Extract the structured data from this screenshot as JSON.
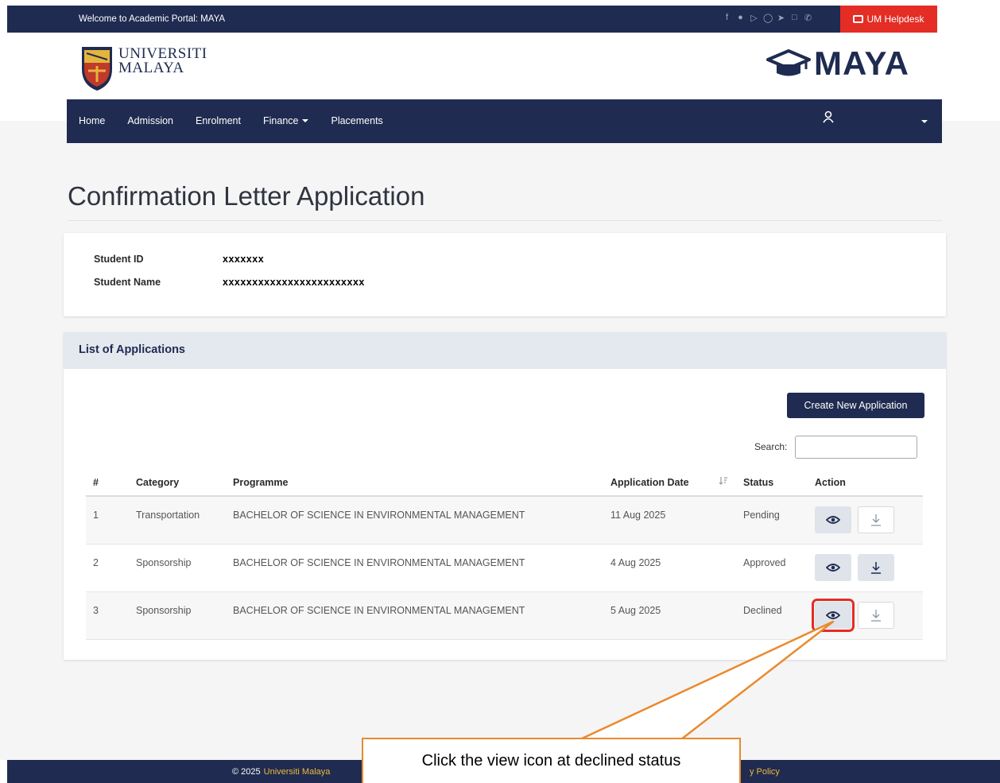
{
  "top_bar": {
    "welcome": "Welcome to Academic Portal: MAYA",
    "social_icons": [
      "facebook-icon",
      "twitter-icon",
      "youtube-icon",
      "instagram-icon",
      "telegram-icon",
      "calendar-icon",
      "phone-icon"
    ],
    "helpdesk_label": "UM Helpdesk"
  },
  "header": {
    "um_line1": "UNIVERSITI",
    "um_line2": "MALAYA",
    "maya": "MAYA"
  },
  "nav": {
    "items": [
      {
        "label": "Home"
      },
      {
        "label": "Admission"
      },
      {
        "label": "Enrolment"
      },
      {
        "label": "Finance",
        "dropdown": true
      },
      {
        "label": "Placements"
      }
    ]
  },
  "page": {
    "title": "Confirmation Letter Application"
  },
  "student": {
    "id_label": "Student ID",
    "id_value": "xxxxxxx",
    "name_label": "Student Name",
    "name_value": "xxxxxxxxxxxxxxxxxxxxxxxx"
  },
  "applications": {
    "title": "List of Applications",
    "create_label": "Create New Application",
    "search_label": "Search:",
    "search_value": "",
    "columns": [
      "#",
      "Category",
      "Programme",
      "Application Date",
      "Status",
      "Action"
    ],
    "rows": [
      {
        "num": "1",
        "category": "Transportation",
        "programme": "BACHELOR OF SCIENCE IN ENVIRONMENTAL MANAGEMENT",
        "date": "11 Aug 2025",
        "status": "Pending"
      },
      {
        "num": "2",
        "category": "Sponsorship",
        "programme": "BACHELOR OF SCIENCE IN ENVIRONMENTAL MANAGEMENT",
        "date": "4 Aug 2025",
        "status": "Approved"
      },
      {
        "num": "3",
        "category": "Sponsorship",
        "programme": "BACHELOR OF SCIENCE IN ENVIRONMENTAL MANAGEMENT",
        "date": "5 Aug 2025",
        "status": "Declined"
      }
    ]
  },
  "footer": {
    "copyright": "© 2025",
    "org": "Universiti Malaya",
    "policy": "y Policy"
  },
  "annotation": {
    "callout": "Click the view icon at declined status"
  },
  "colors": {
    "navy": "#1f2b50",
    "helpdesk_red": "#e32d25",
    "callout_orange": "#e98a2c",
    "footer_accent": "#f0b93a"
  }
}
